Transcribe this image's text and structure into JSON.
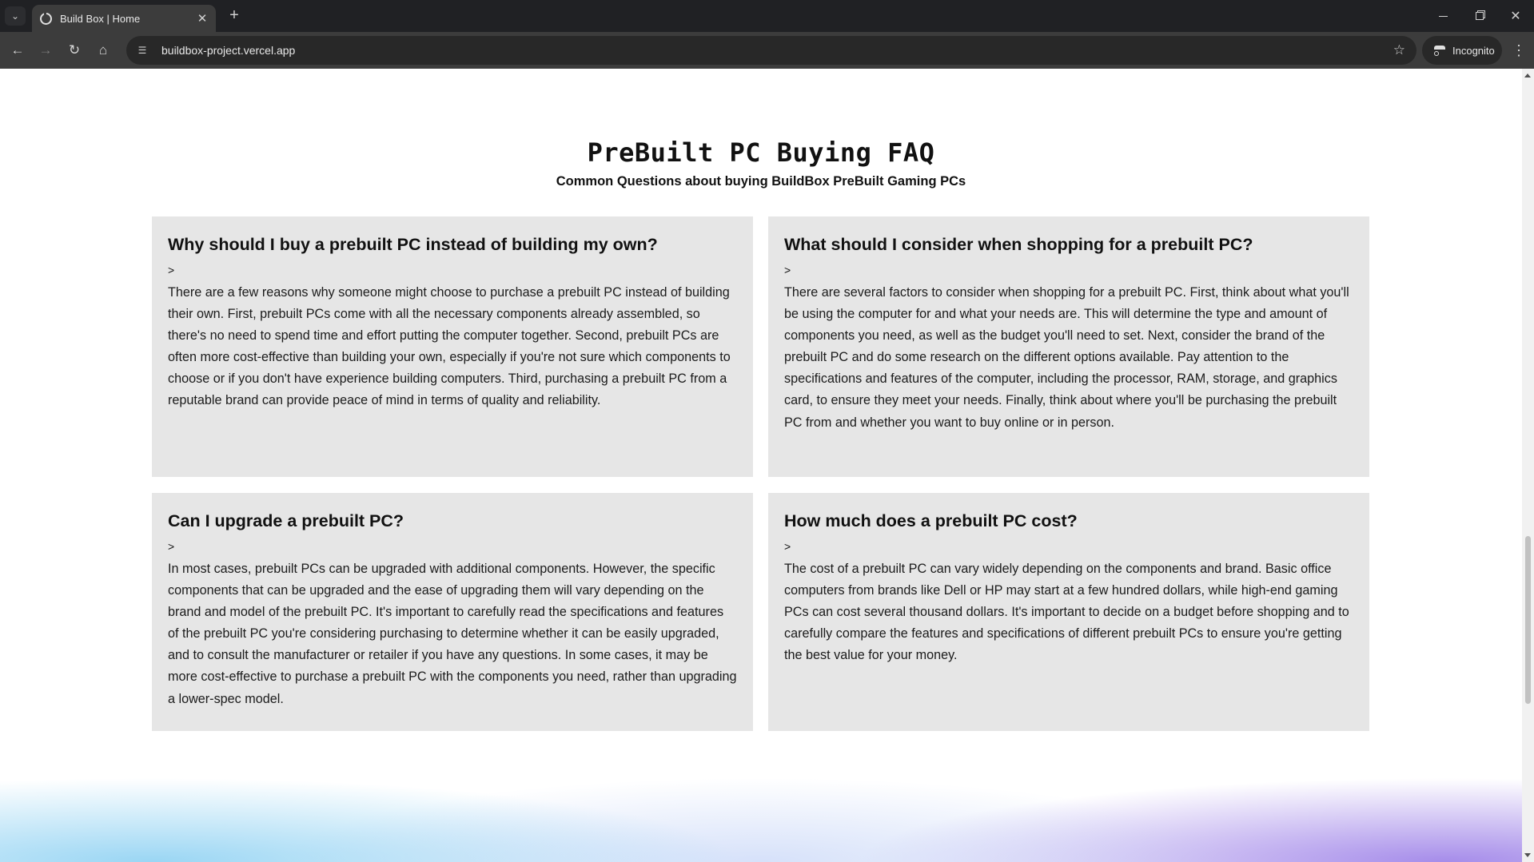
{
  "browser": {
    "tab_title": "Build Box | Home",
    "tab_close": "✕",
    "new_tab": "+",
    "url": "buildbox-project.vercel.app",
    "incognito_label": "Incognito",
    "icons": {
      "tab_search": "chevron-down-icon",
      "back": "arrow-left-icon",
      "forward": "arrow-right-icon",
      "reload": "reload-icon",
      "home": "home-icon",
      "site_info": "tune-icon",
      "bookmark": "star-icon",
      "menu": "kebab-icon"
    }
  },
  "faq": {
    "title": "PreBuilt PC Buying FAQ",
    "subtitle": "Common Questions about buying BuildBox PreBuilt Gaming PCs",
    "items": [
      {
        "question": "Why should I buy a prebuilt PC instead of building my own?",
        "toggle": ">",
        "answer": "There are a few reasons why someone might choose to purchase a prebuilt PC instead of building their own. First, prebuilt PCs come with all the necessary components already assembled, so there's no need to spend time and effort putting the computer together. Second, prebuilt PCs are often more cost-effective than building your own, especially if you're not sure which components to choose or if you don't have experience building computers. Third, purchasing a prebuilt PC from a reputable brand can provide peace of mind in terms of quality and reliability."
      },
      {
        "question": "What should I consider when shopping for a prebuilt PC?",
        "toggle": ">",
        "answer": "There are several factors to consider when shopping for a prebuilt PC. First, think about what you'll be using the computer for and what your needs are. This will determine the type and amount of components you need, as well as the budget you'll need to set. Next, consider the brand of the prebuilt PC and do some research on the different options available. Pay attention to the specifications and features of the computer, including the processor, RAM, storage, and graphics card, to ensure they meet your needs. Finally, think about where you'll be purchasing the prebuilt PC from and whether you want to buy online or in person."
      },
      {
        "question": "Can I upgrade a prebuilt PC?",
        "toggle": ">",
        "answer": "In most cases, prebuilt PCs can be upgraded with additional components. However, the specific components that can be upgraded and the ease of upgrading them will vary depending on the brand and model of the prebuilt PC. It's important to carefully read the specifications and features of the prebuilt PC you're considering purchasing to determine whether it can be easily upgraded, and to consult the manufacturer or retailer if you have any questions. In some cases, it may be more cost-effective to purchase a prebuilt PC with the components you need, rather than upgrading a lower-spec model."
      },
      {
        "question": "How much does a prebuilt PC cost?",
        "toggle": ">",
        "answer": "The cost of a prebuilt PC can vary widely depending on the components and brand. Basic office computers from brands like Dell or HP may start at a few hundred dollars, while high-end gaming PCs can cost several thousand dollars. It's important to decide on a budget before shopping and to carefully compare the features and specifications of different prebuilt PCs to ensure you're getting the best value for your money."
      }
    ]
  },
  "colors": {
    "card_background": "#e6e6e6",
    "chrome_dark": "#202124",
    "toolbar": "#3c3c3c"
  }
}
